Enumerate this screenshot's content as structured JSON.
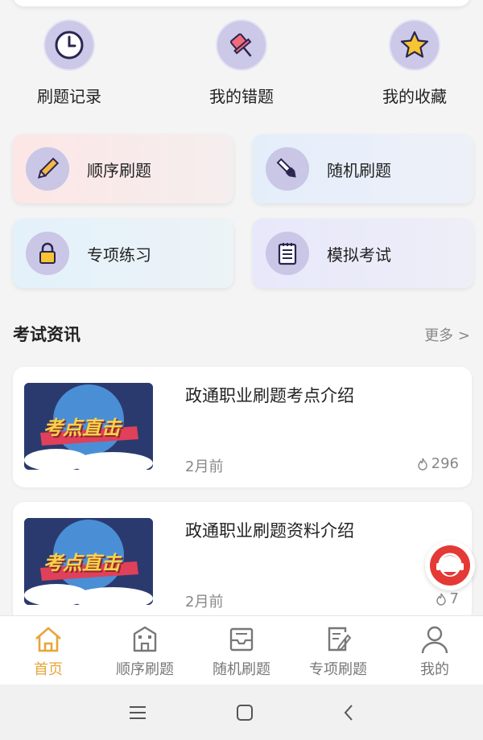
{
  "quick_actions": [
    {
      "label": "刷题记录",
      "icon": "clock-icon"
    },
    {
      "label": "我的错题",
      "icon": "pushpin-icon"
    },
    {
      "label": "我的收藏",
      "icon": "star-icon"
    }
  ],
  "tiles": [
    {
      "label": "顺序刷题",
      "icon": "pencil-icon"
    },
    {
      "label": "随机刷题",
      "icon": "brush-icon"
    },
    {
      "label": "专项练习",
      "icon": "lock-icon"
    },
    {
      "label": "模拟考试",
      "icon": "notepad-icon"
    }
  ],
  "news_section": {
    "title": "考试资讯",
    "more": "更多 >"
  },
  "news": [
    {
      "title": "政通职业刷题考点介绍",
      "time": "2月前",
      "views": "296",
      "thumb_text": "考点直击"
    },
    {
      "title": "政通职业刷题资料介绍",
      "time": "2月前",
      "views": "7",
      "thumb_text": "考点直击"
    }
  ],
  "tabbar": [
    {
      "label": "首页",
      "icon": "home-icon",
      "active": true
    },
    {
      "label": "顺序刷题",
      "icon": "building-icon"
    },
    {
      "label": "随机刷题",
      "icon": "inbox-icon"
    },
    {
      "label": "专项刷题",
      "icon": "edit-doc-icon"
    },
    {
      "label": "我的",
      "icon": "user-icon"
    }
  ],
  "colors": {
    "accent": "#e7a53a",
    "icon_circle": "#cbc8e8",
    "icon_stroke": "#2a2550"
  }
}
